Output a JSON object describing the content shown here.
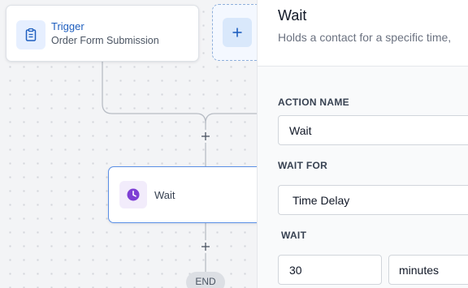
{
  "workflow": {
    "trigger": {
      "title": "Trigger",
      "subtitle": "Order Form Submission",
      "icon": "clipboard-icon"
    },
    "add_action": {
      "icon": "plus-icon"
    },
    "wait_node": {
      "label": "Wait",
      "icon": "clock-icon"
    },
    "end_label": "END"
  },
  "panel": {
    "title": "Wait",
    "description": "Holds a contact for a specific time,",
    "action_name": {
      "label": "ACTION NAME",
      "value": "Wait"
    },
    "wait_for": {
      "label": "WAIT FOR",
      "value": "Time Delay"
    },
    "wait": {
      "label": "WAIT",
      "amount": "30",
      "unit": "minutes"
    }
  },
  "colors": {
    "accent": "#1f5fbf",
    "wait_icon": "#7e3fd4",
    "selected_border": "#5a8fe6"
  }
}
